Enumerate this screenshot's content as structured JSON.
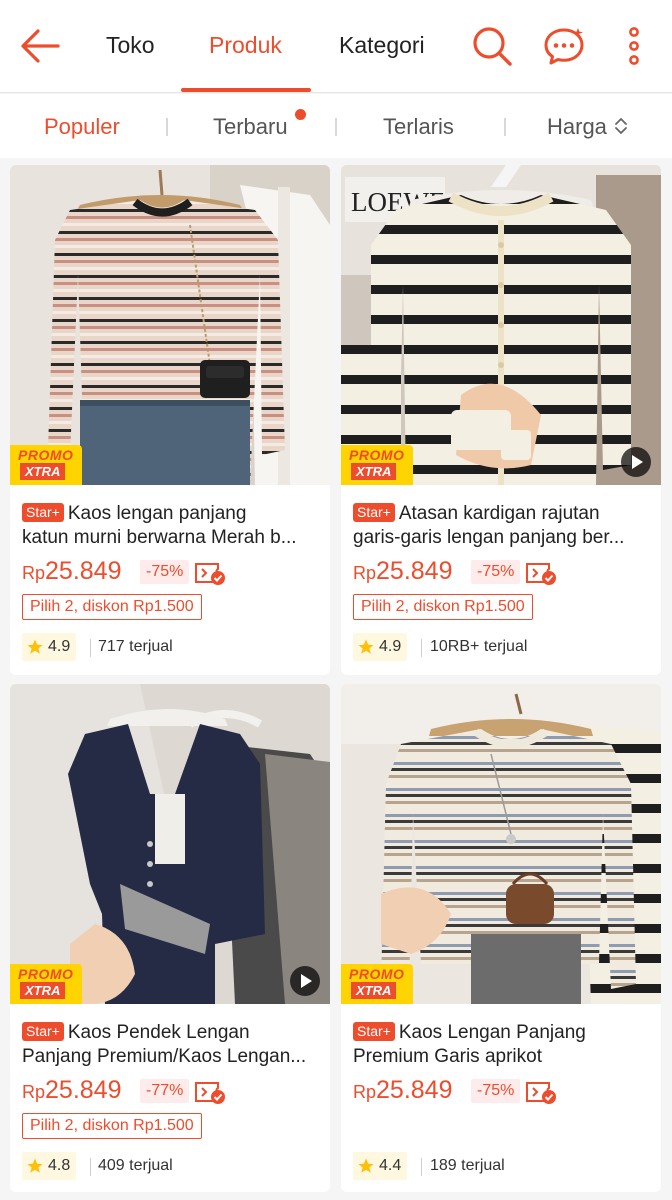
{
  "header": {
    "tabs": [
      "Toko",
      "Produk",
      "Kategori"
    ],
    "active_tab": "Produk"
  },
  "sortbar": {
    "options": [
      "Populer",
      "Terbaru",
      "Terlaris",
      "Harga"
    ],
    "active": "Populer"
  },
  "products": [
    {
      "badge": "Star+",
      "title_line1": "Kaos lengan panjang",
      "title_line2": "katun murni berwarna Merah b...",
      "currency": "Rp",
      "price": "25.849",
      "discount": "-75%",
      "voucher": "Pilih 2, diskon Rp1.500",
      "rating": "4.9",
      "sold": "717 terjual",
      "promo_top": "PROMO",
      "promo_bottom": "XTRA",
      "has_video": false
    },
    {
      "badge": "Star+",
      "title_line1": "Atasan kardigan rajutan",
      "title_line2": "garis-garis lengan panjang ber...",
      "currency": "Rp",
      "price": "25.849",
      "discount": "-75%",
      "voucher": "Pilih 2, diskon Rp1.500",
      "rating": "4.9",
      "sold": "10RB+ terjual",
      "promo_top": "PROMO",
      "promo_bottom": "XTRA",
      "has_video": true,
      "hanger_tag": "LOEWE"
    },
    {
      "badge": "Star+",
      "title_line1": "Kaos Pendek Lengan",
      "title_line2": "Panjang Premium/Kaos Lengan...",
      "currency": "Rp",
      "price": "25.849",
      "discount": "-77%",
      "voucher": "Pilih 2, diskon Rp1.500",
      "rating": "4.8",
      "sold": "409 terjual",
      "promo_top": "PROMO",
      "promo_bottom": "XTRA",
      "has_video": true
    },
    {
      "badge": "Star+",
      "title_line1": "Kaos Lengan Panjang",
      "title_line2": "Premium Garis aprikot",
      "currency": "Rp",
      "price": "25.849",
      "discount": "-75%",
      "voucher": "",
      "rating": "4.4",
      "sold": "189 terjual",
      "promo_top": "PROMO",
      "promo_bottom": "XTRA",
      "has_video": false
    }
  ],
  "colors": {
    "accent": "#ee4d2d",
    "promo_yellow": "#ffd400",
    "star": "#ffc107"
  }
}
